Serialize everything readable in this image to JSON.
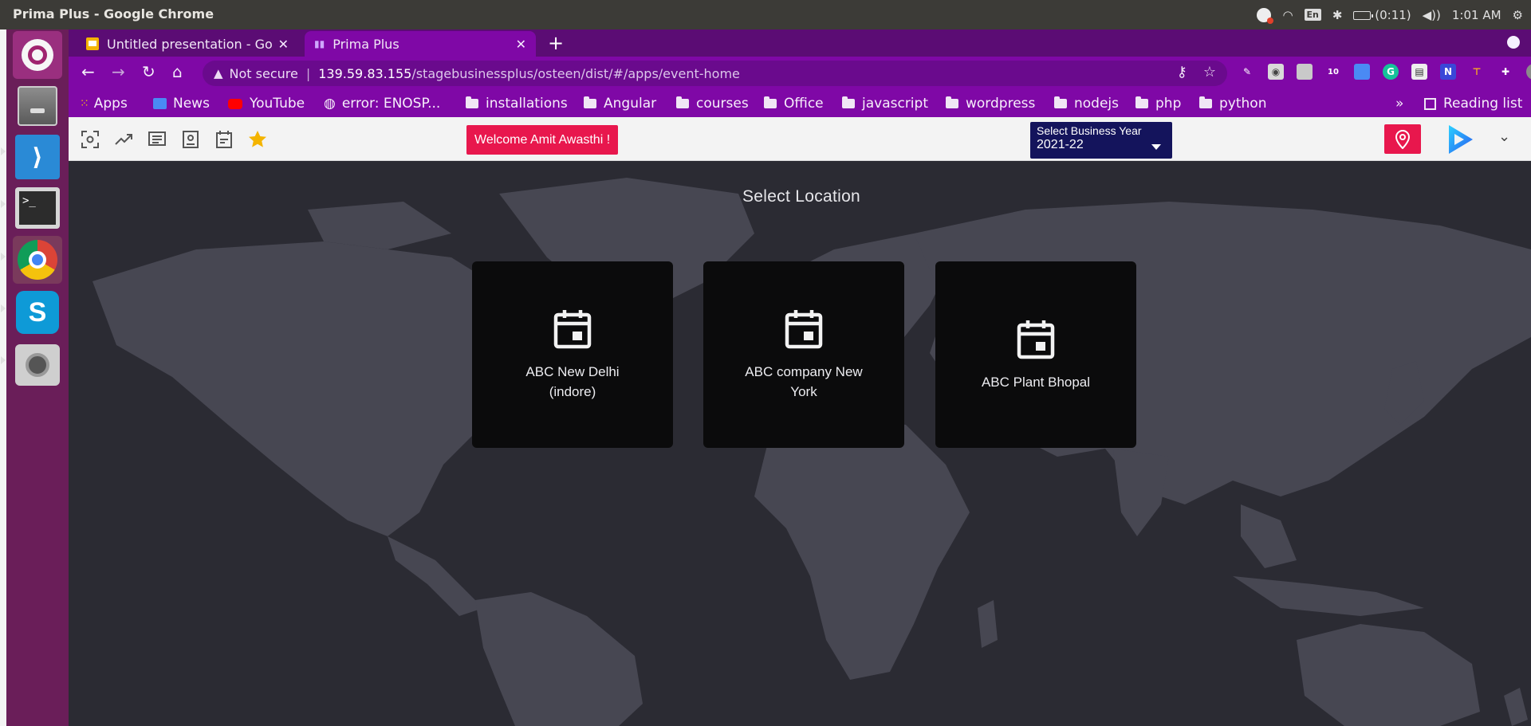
{
  "os": {
    "window_title": "Prima Plus - Google Chrome",
    "keyboard_layout": "En",
    "battery_text": "(0:11)",
    "clock": "1:01 AM"
  },
  "launcher": {
    "apps": [
      "ubuntu-home-icon",
      "files-icon",
      "vscode-icon",
      "terminal-icon",
      "chrome-icon",
      "skype-icon",
      "camera-icon"
    ]
  },
  "browser": {
    "tabs": [
      {
        "title": "Untitled presentation - Go",
        "active": false,
        "icon": "slides-icon"
      },
      {
        "title": "Prima Plus",
        "active": true,
        "icon": "chart-favicon-icon"
      }
    ],
    "new_tab_label": "+",
    "security_label": "Not secure",
    "url_host": "139.59.83.155",
    "url_path": "/stagebusinessplus/osteen/dist/#/apps/event-home",
    "bookmarks": [
      {
        "label": "Apps",
        "icon": "apps-grid-icon"
      },
      {
        "label": "News",
        "icon": "news-icon"
      },
      {
        "label": "YouTube",
        "icon": "youtube-icon"
      },
      {
        "label": "error: ENOSP...",
        "icon": "globe-icon"
      },
      {
        "label": "installations",
        "icon": "folder-icon"
      },
      {
        "label": "Angular",
        "icon": "folder-icon"
      },
      {
        "label": "courses",
        "icon": "folder-icon"
      },
      {
        "label": "Office",
        "icon": "folder-icon"
      },
      {
        "label": "javascript",
        "icon": "folder-icon"
      },
      {
        "label": "wordpress",
        "icon": "folder-icon"
      },
      {
        "label": "nodejs",
        "icon": "folder-icon"
      },
      {
        "label": "php",
        "icon": "folder-icon"
      },
      {
        "label": "python",
        "icon": "folder-icon"
      }
    ],
    "overflow_label": "»",
    "reading_list_label": "Reading list",
    "extension_badge": "10"
  },
  "app": {
    "welcome_text": "Welcome  Amit Awasthi !",
    "business_year_label": "Select Business Year",
    "business_year_value": "2021-22",
    "page_title": "Select Location",
    "locations": [
      {
        "name": "ABC New Delhi (indore)"
      },
      {
        "name": "ABC company New York"
      },
      {
        "name": "ABC Plant Bhopal"
      }
    ],
    "colors": {
      "accent_pink": "#e8174d",
      "year_select_bg": "#14145c",
      "browser_purple": "#7f08a6",
      "card_bg": "#0b0b0c",
      "map_bg": "#2b2b33"
    }
  }
}
